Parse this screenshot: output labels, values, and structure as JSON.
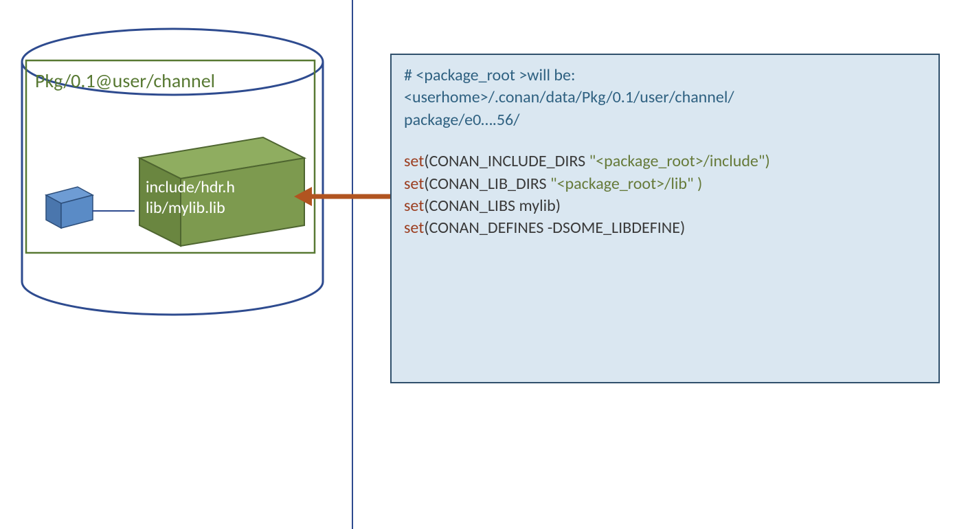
{
  "package": {
    "label": "Pkg/0.1@user/channel",
    "contents_line1": "include/hdr.h",
    "contents_line2": "lib/mylib.lib"
  },
  "code": {
    "comment1": "# <package_root >will be:",
    "comment2": "<userhome>/.conan/data/Pkg/0.1/user/channel/",
    "comment3": "package/e0….56/",
    "set1_kw": "set",
    "set1_key": "(CONAN_INCLUDE_DIRS ",
    "set1_val": "\"<package_root>/include\")",
    "set2_kw": "set",
    "set2_key": "(CONAN_LIB_DIRS  ",
    "set2_val": "\"<package_root>/lib\" )",
    "set3_kw": "set",
    "set3_rest": "(CONAN_LIBS mylib)",
    "set4_kw": "set",
    "set4_rest": "(CONAN_DEFINES -DSOME_LIBDEFINE)"
  },
  "colors": {
    "cylinder_stroke": "#2e4b8f",
    "inner_rect_stroke": "#587933",
    "cube_green_fill": "#7d9a4f",
    "cube_green_top": "#8fad60",
    "cube_green_side": "#6a8640",
    "cube_blue_fill": "#5a8bc6",
    "cube_blue_top": "#6e9cd4",
    "cube_blue_side": "#4a76ad",
    "arrow": "#b15420",
    "divider": "#2e4b8f",
    "codebox_bg": "#dae7f1",
    "codebox_border": "#30506c"
  }
}
